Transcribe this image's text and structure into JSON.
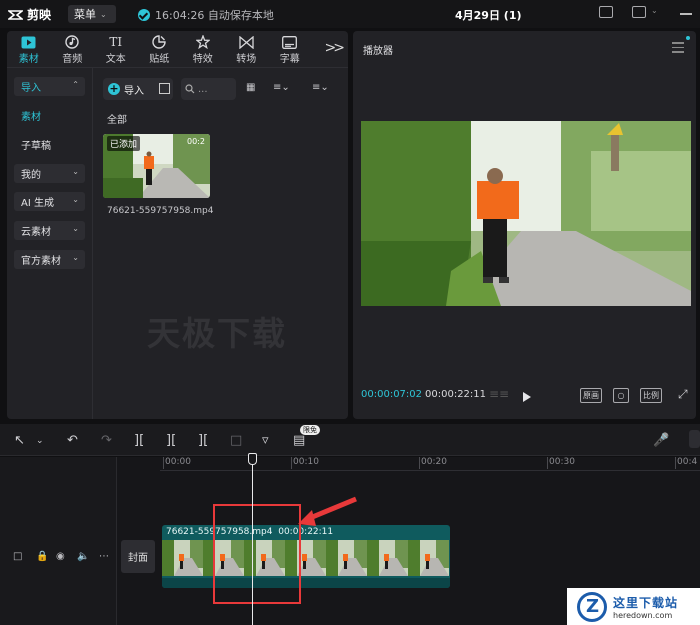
{
  "app": {
    "name": "剪映",
    "menu_label": "菜单",
    "save_status": "16:04:26 自动保存本地",
    "project_title": "4月29日 (1)"
  },
  "tabs": [
    {
      "label": "素材",
      "icon": "media-icon"
    },
    {
      "label": "音频",
      "icon": "audio-icon"
    },
    {
      "label": "文本",
      "icon": "text-icon"
    },
    {
      "label": "贴纸",
      "icon": "sticker-icon"
    },
    {
      "label": "特效",
      "icon": "effects-icon"
    },
    {
      "label": "转场",
      "icon": "transition-icon"
    },
    {
      "label": "字幕",
      "icon": "caption-icon"
    }
  ],
  "tab_glyphs": {
    "text": "TI"
  },
  "sidebar": {
    "items": [
      {
        "label": "导入"
      },
      {
        "label": "素材"
      },
      {
        "label": "子草稿"
      },
      {
        "label": "我的"
      },
      {
        "label": "AI 生成"
      },
      {
        "label": "云素材"
      },
      {
        "label": "官方素材"
      }
    ]
  },
  "media": {
    "import_label": "导入",
    "search_placeholder": "...",
    "section_label": "全部",
    "added_badge": "已添加",
    "thumb_duration": "00:2",
    "file_name": "76621-559757958.mp4",
    "watermark": "天极下载"
  },
  "player": {
    "title": "播放器",
    "time_current": "00:00:07:02",
    "time_total": "00:00:22:11",
    "original_label": "原画",
    "ratio_label": "比例"
  },
  "timeline": {
    "free_badge": "限免",
    "ticks": [
      "00:00",
      "00:10",
      "00:20",
      "00:30",
      "00:4"
    ],
    "cover_label": "封面",
    "clip_name": "76621-559757958.mp4",
    "clip_duration": "00:00:22:11"
  },
  "corner_logo": {
    "cn": "这里下载站",
    "en": "heredown.com"
  },
  "colors": {
    "accent": "#2ec4d6",
    "clip_bg": "#0f5b5e",
    "annotation": "#e8393a"
  }
}
